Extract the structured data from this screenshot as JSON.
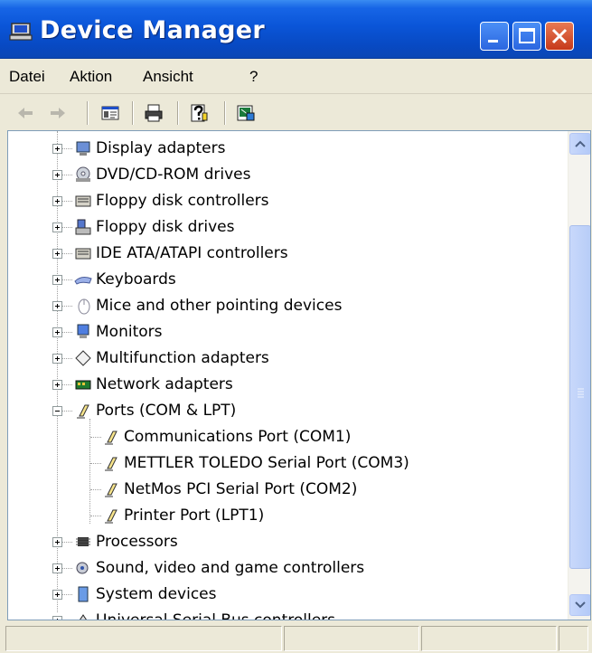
{
  "window": {
    "title": "Device Manager"
  },
  "menu": {
    "items": [
      "Datei",
      "Aktion",
      "Ansicht",
      "?"
    ]
  },
  "toolbar": {
    "buttons": [
      "back-arrow-icon",
      "forward-arrow-icon",
      "console-tree-icon",
      "print-icon",
      "help-icon",
      "properties-icon"
    ]
  },
  "tree": {
    "nodes": [
      {
        "label": "Display adapters",
        "icon": "display-adapter-icon",
        "expanded": false
      },
      {
        "label": "DVD/CD-ROM drives",
        "icon": "cd-drive-icon",
        "expanded": false
      },
      {
        "label": "Floppy disk controllers",
        "icon": "controller-icon",
        "expanded": false
      },
      {
        "label": "Floppy disk drives",
        "icon": "floppy-drive-icon",
        "expanded": false
      },
      {
        "label": "IDE ATA/ATAPI controllers",
        "icon": "controller-icon",
        "expanded": false
      },
      {
        "label": "Keyboards",
        "icon": "keyboard-icon",
        "expanded": false
      },
      {
        "label": "Mice and other pointing devices",
        "icon": "mouse-icon",
        "expanded": false
      },
      {
        "label": "Monitors",
        "icon": "monitor-icon",
        "expanded": false
      },
      {
        "label": "Multifunction adapters",
        "icon": "multifunction-icon",
        "expanded": false
      },
      {
        "label": "Network adapters",
        "icon": "network-adapter-icon",
        "expanded": false
      },
      {
        "label": "Ports (COM & LPT)",
        "icon": "port-icon",
        "expanded": true
      },
      {
        "label": "Processors",
        "icon": "processor-icon",
        "expanded": false
      },
      {
        "label": "Sound, video and game controllers",
        "icon": "sound-icon",
        "expanded": false
      },
      {
        "label": "System devices",
        "icon": "system-device-icon",
        "expanded": false
      },
      {
        "label": "Universal Serial Bus controllers",
        "icon": "usb-icon",
        "expanded": false
      }
    ],
    "ports_children": [
      "Communications Port (COM1)",
      "METTLER TOLEDO Serial Port (COM3)",
      "NetMos PCI Serial Port (COM2)",
      "Printer Port (LPT1)"
    ]
  },
  "colors": {
    "titlebar": "#0a55d8",
    "close_button": "#c6391a",
    "window_bg": "#ece9d8",
    "scrollbar_thumb": "#b8cdf7"
  }
}
